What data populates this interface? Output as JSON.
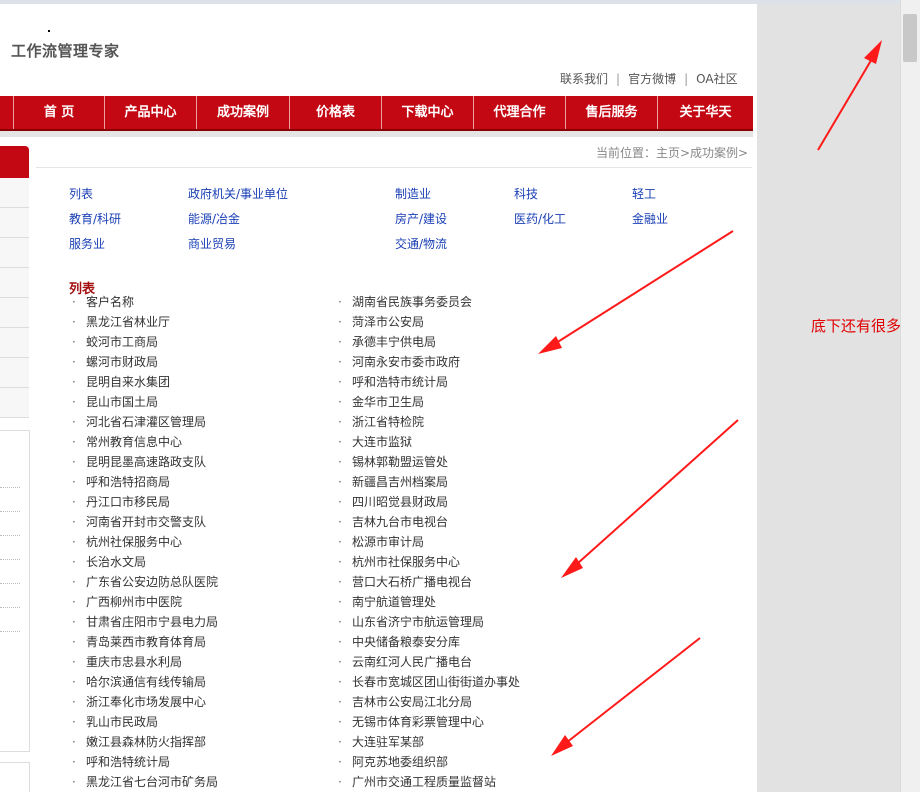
{
  "header": {
    "tagline": "工作流管理专家",
    "top_links": [
      "联系我们",
      "官方微博",
      "OA社区"
    ],
    "separator": "|"
  },
  "nav": {
    "items": [
      "首 页",
      "产品中心",
      "成功案例",
      "价格表",
      "下载中心",
      "代理合作",
      "售后服务",
      "关于华天"
    ]
  },
  "location": "当前位置：主页>成功案例>",
  "categories": [
    "列表",
    "政府机关/事业单位",
    "制造业",
    "科技",
    "轻工",
    "教育/科研",
    "能源/冶金",
    "房产/建设",
    "医药/化工",
    "金融业",
    "服务业",
    "商业贸易",
    "交通/物流"
  ],
  "list_title": "列表",
  "bullet": "·",
  "left_column": [
    "客户名称",
    "黑龙江省林业厅",
    "蛟河市工商局",
    "螺河市财政局",
    "昆明自来水集团",
    "昆山市国土局",
    "河北省石津灌区管理局",
    "常州教育信息中心",
    "昆明昆墨高速路政支队",
    "呼和浩特招商局",
    "丹江口市移民局",
    "河南省开封市交警支队",
    "杭州社保服务中心",
    "长治水文局",
    "广东省公安边防总队医院",
    "广西柳州市中医院",
    "甘肃省庄阳市宁县电力局",
    "青岛莱西市教育体育局",
    "重庆市忠县水利局",
    "哈尔滨通信有线传输局",
    "浙江奉化市场发展中心",
    "乳山市民政局",
    "嫩江县森林防火指挥部",
    "呼和浩特统计局",
    "黑龙江省七台河市矿务局"
  ],
  "right_column": [
    "湖南省民族事务委员会",
    "菏泽市公安局",
    "承德丰宁供电局",
    "河南永安市委市政府",
    "呼和浩特市统计局",
    "金华市卫生局",
    "浙江省特检院",
    "大连市监狱",
    "锡林郭勒盟运管处",
    "新疆昌吉州档案局",
    "四川昭觉县财政局",
    "吉林九台市电视台",
    "松源市审计局",
    "杭州市社保服务中心",
    "营口大石桥广播电视台",
    "南宁航道管理处",
    "山东省济宁市航运管理局",
    "中央储备粮泰安分库",
    "云南红河人民广播电台",
    "长春市宽城区团山街街道办事处",
    "吉林市公安局江北分局",
    "无锡市体育彩票管理中心",
    "大连驻军某部",
    "阿克苏地委组织部",
    "广州市交通工程质量监督站"
  ],
  "annotation": "底下还有很多",
  "colors": {
    "nav_red": "#c40813",
    "link_blue": "#1a3fb5",
    "title_red": "#a31010",
    "annotation_red": "#e00000"
  }
}
